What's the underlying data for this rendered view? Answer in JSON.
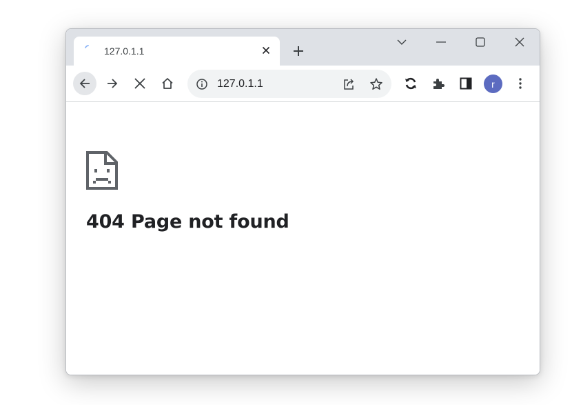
{
  "tab": {
    "title": "127.0.1.1"
  },
  "omnibox": {
    "url": "127.0.1.1"
  },
  "profile": {
    "initial": "r",
    "color": "#5c6bc0"
  },
  "error_page": {
    "heading": "404 Page not found"
  },
  "icons": {
    "tab": [
      "loading-spinner-icon",
      "close-icon"
    ],
    "titlebar": [
      "new-tab-icon",
      "tab-search-icon",
      "minimize-icon",
      "maximize-icon",
      "window-close-icon"
    ],
    "toolbar": [
      "back-arrow-icon",
      "forward-arrow-icon",
      "stop-icon",
      "home-icon",
      "site-info-icon",
      "share-icon",
      "bookmark-star-icon",
      "sync-icon",
      "extensions-puzzle-icon",
      "side-panel-icon",
      "more-menu-icon"
    ],
    "content": [
      "sad-page-icon"
    ]
  },
  "colors": {
    "titlebar": "#dee1e6",
    "omnibox_bg": "#f1f3f4",
    "text": "#202124"
  }
}
